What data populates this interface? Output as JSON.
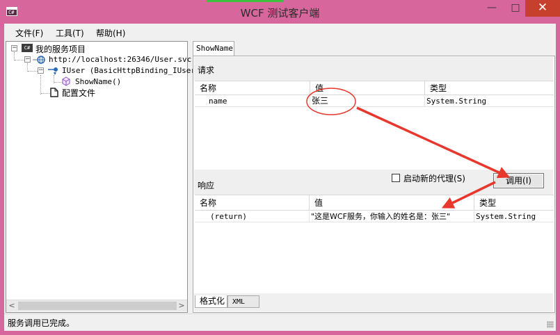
{
  "window": {
    "title": "WCF 测试客户端",
    "app_icon_text": "C#",
    "minimize_glyph": "—",
    "maximize_glyph": "□",
    "close_glyph": "✕"
  },
  "menu": {
    "file": "文件(F)",
    "tools": "工具(T)",
    "help": "帮助(H)"
  },
  "tree": {
    "project_icon_text": "C#",
    "project": "我的服务项目",
    "endpoint": "http://localhost:26346/User.svc",
    "contract": "IUser (BasicHttpBinding_IUser)",
    "operation": "ShowName()",
    "config": "配置文件",
    "expander_glyph": "−"
  },
  "scrollbar": {
    "left_arrow": "<",
    "right_arrow": ">"
  },
  "tab": {
    "label": "ShowName"
  },
  "request": {
    "label": "请求",
    "columns": [
      "名称",
      "值",
      "类型"
    ],
    "rows": [
      {
        "name": "name",
        "value": "张三",
        "type": "System.String"
      }
    ]
  },
  "proxy_checkbox": {
    "label": "启动新的代理(S)",
    "checked": false
  },
  "invoke_button": {
    "label": "调用(I)"
  },
  "response": {
    "label": "响应",
    "columns": [
      "名称",
      "值",
      "类型"
    ],
    "rows": [
      {
        "name": "(return)",
        "value": "\"这是WCF服务，你输入的姓名是：张三\"",
        "type": "System.String"
      }
    ]
  },
  "bottom_tabs": [
    "格式化",
    "XML"
  ],
  "status": {
    "text": "服务调用已完成。"
  },
  "colors": {
    "title_bar": "#d6669c",
    "close_button": "#c7402e",
    "annotation": "#e8382e"
  }
}
